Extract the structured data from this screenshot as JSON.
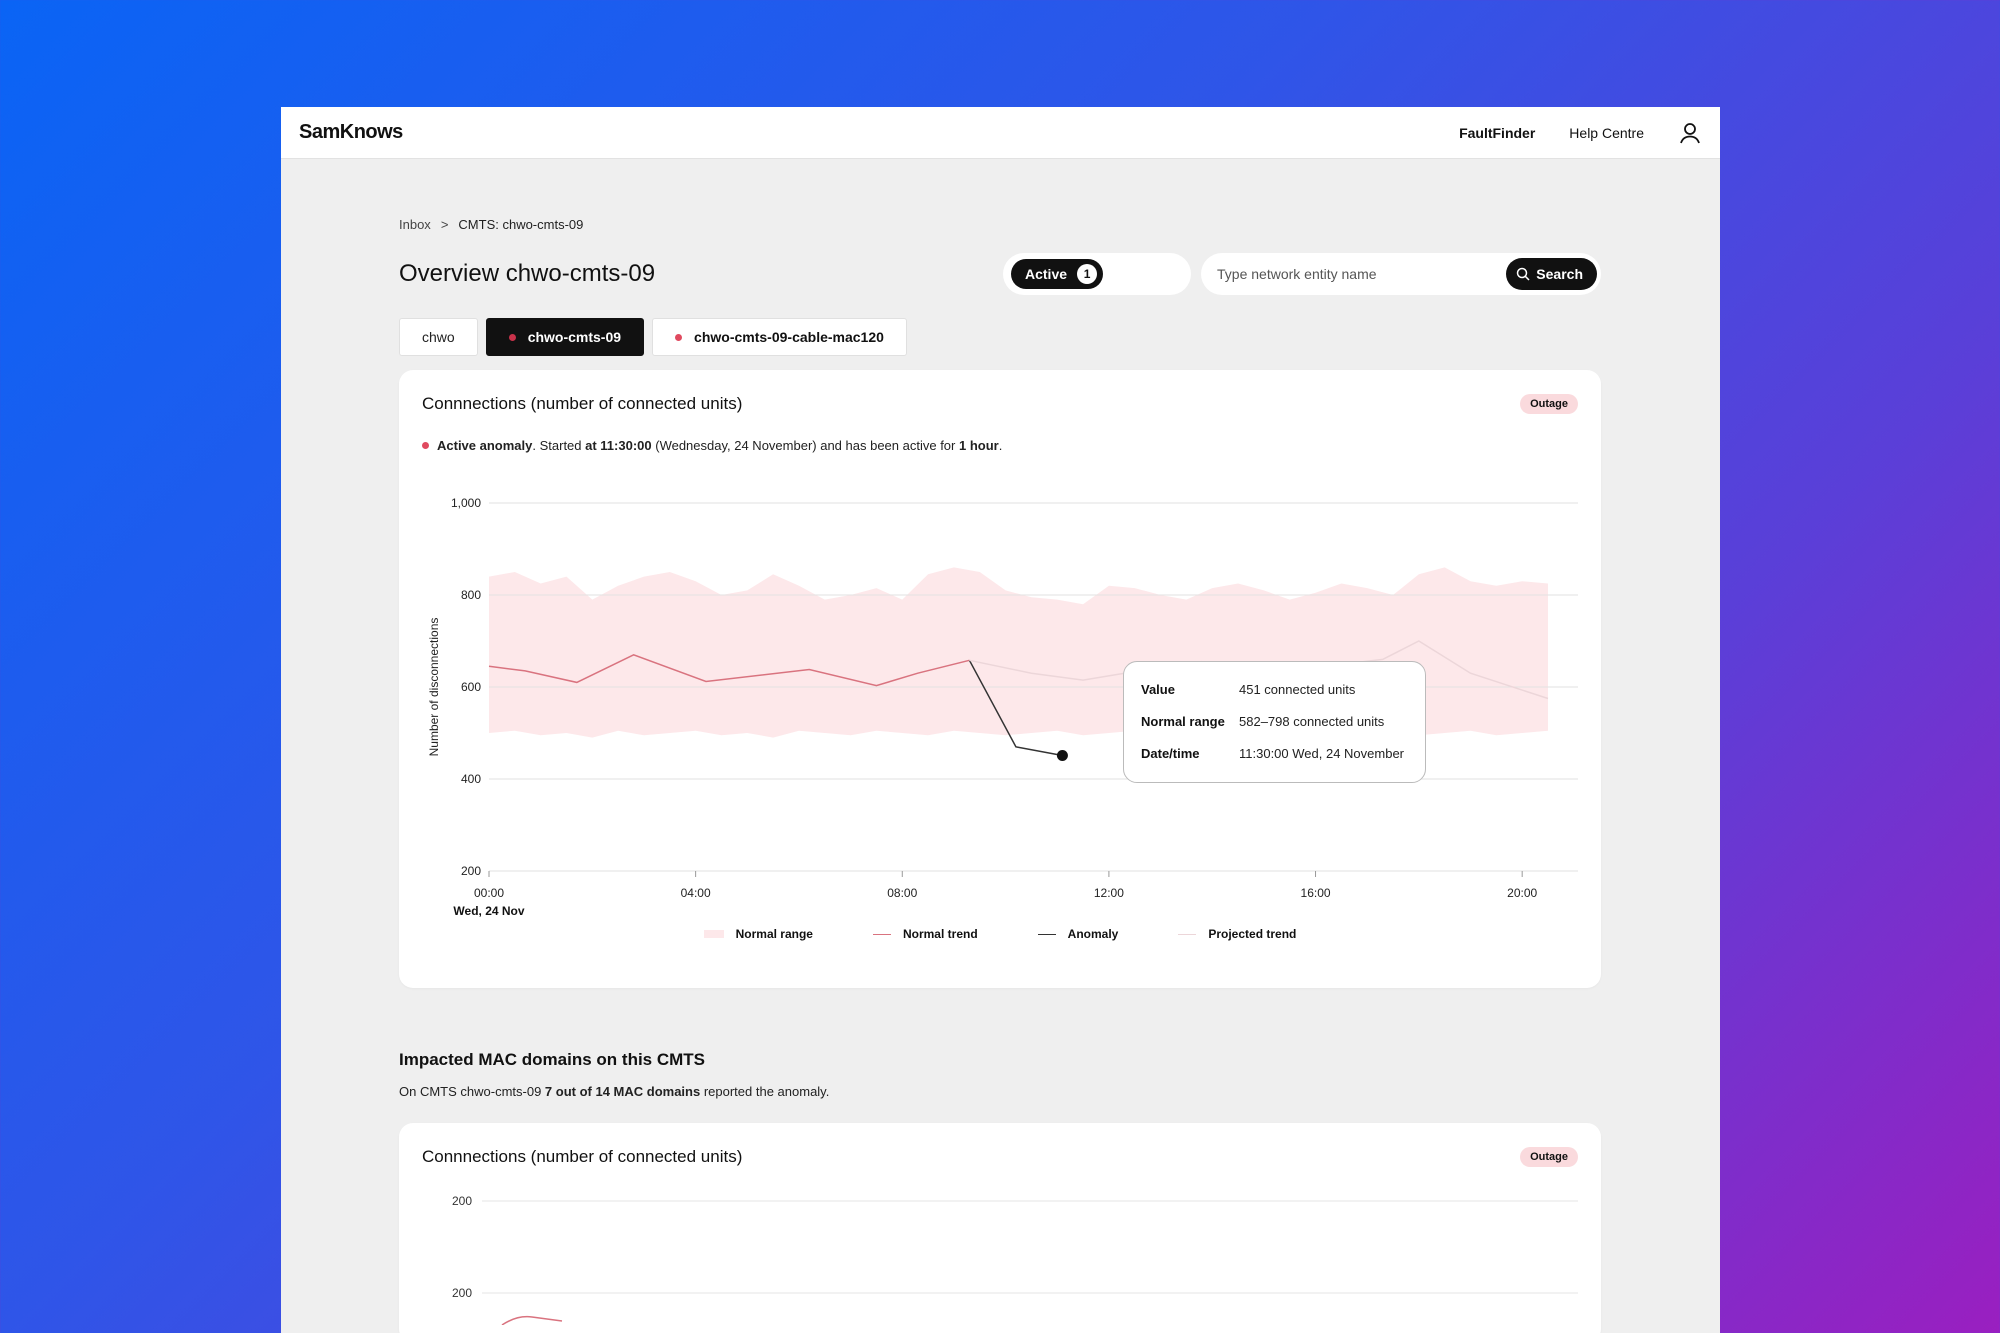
{
  "brand": "SamKnows",
  "nav": {
    "primary": "FaultFinder",
    "help": "Help Centre",
    "profile_icon": "user-icon"
  },
  "breadcrumb": {
    "root": "Inbox",
    "separator": ">",
    "current": "CMTS: chwo-cmts-09"
  },
  "page_title": "Overview chwo-cmts-09",
  "status": {
    "label": "Active",
    "count": "1"
  },
  "search": {
    "placeholder": "Type network entity name",
    "button": "Search"
  },
  "tabs": [
    {
      "label": "chwo",
      "dot": false,
      "active": false
    },
    {
      "label": "chwo-cmts-09",
      "dot": true,
      "active": true
    },
    {
      "label": "chwo-cmts-09-cable-mac120",
      "dot": true,
      "active": false
    }
  ],
  "card1": {
    "title": "Connnections (number of connected units)",
    "badge": "Outage",
    "anomaly": {
      "bold1": "Active anomaly",
      "t1": ". Started ",
      "bold2": "at 11:30:00",
      "t2": " (Wednesday, 24 November) and has been active for ",
      "bold3": "1 hour",
      "t3": "."
    },
    "tooltip": {
      "value_label": "Value",
      "value": "451 connected units",
      "range_label": "Normal range",
      "range": "582–798 connected units",
      "date_label": "Date/time",
      "date": "11:30:00 Wed, 24 November"
    },
    "legend": [
      "Normal range",
      "Normal trend",
      "Anomaly",
      "Projected trend"
    ]
  },
  "chart_data": {
    "type": "line",
    "title": "Connnections (number of connected units)",
    "ylabel": "Number of disconnections",
    "xlabel": "",
    "ylim": [
      200,
      1000
    ],
    "yticks": [
      "1,000",
      "800",
      "600",
      "400",
      "200"
    ],
    "yticks_values": [
      1000,
      800,
      600,
      400,
      200
    ],
    "xlim": [
      0,
      20.5
    ],
    "xticks": [
      "00:00",
      "04:00",
      "08:00",
      "12:00",
      "16:00",
      "20:00"
    ],
    "xticks_values": [
      0,
      4,
      8,
      12,
      16,
      20
    ],
    "xsub": "Wed, 24 Nov",
    "normal_range": {
      "x": [
        0,
        0.5,
        1,
        1.5,
        2,
        2.5,
        3,
        3.5,
        4,
        4.5,
        5,
        5.5,
        6,
        6.5,
        7,
        7.5,
        8,
        8.5,
        9,
        9.5,
        10,
        10.5,
        11,
        11.5,
        12,
        12.5,
        13,
        13.5,
        14,
        14.5,
        15,
        15.5,
        16,
        16.5,
        17,
        17.5,
        18,
        18.5,
        19,
        19.5,
        20,
        20.5
      ],
      "upper": [
        840,
        850,
        825,
        840,
        790,
        820,
        840,
        850,
        830,
        800,
        810,
        845,
        820,
        790,
        800,
        815,
        790,
        845,
        860,
        850,
        810,
        795,
        790,
        780,
        820,
        815,
        800,
        790,
        815,
        825,
        810,
        790,
        805,
        825,
        815,
        800,
        845,
        860,
        830,
        820,
        830,
        825
      ],
      "lower": [
        500,
        505,
        495,
        500,
        490,
        505,
        495,
        500,
        505,
        495,
        500,
        490,
        505,
        500,
        495,
        505,
        500,
        495,
        505,
        500,
        495,
        500,
        505,
        495,
        500,
        505,
        495,
        500,
        505,
        500,
        495,
        505,
        500,
        495,
        500,
        505,
        495,
        500,
        505,
        495,
        500,
        505
      ]
    },
    "series": [
      {
        "name": "Normal trend",
        "color": "#d9737f",
        "x": [
          0,
          0.7,
          1.7,
          2.8,
          4.2,
          6.2,
          7.5,
          8.3,
          9.3
        ],
        "y": [
          645,
          635,
          610,
          670,
          612,
          638,
          603,
          630,
          658
        ]
      },
      {
        "name": "Anomaly",
        "color": "#333333",
        "x": [
          9.3,
          10.2,
          11.1
        ],
        "y": [
          658,
          470,
          451
        ]
      },
      {
        "name": "Projected trend",
        "color": "#ecd6d9",
        "x": [
          9.3,
          10.5,
          11.5,
          12.3,
          13,
          13.8,
          14.8,
          15.8,
          17.3,
          18,
          19,
          20.5
        ],
        "y": [
          658,
          630,
          615,
          630,
          625,
          655,
          625,
          640,
          660,
          700,
          630,
          575
        ]
      }
    ],
    "anomaly_point": {
      "x": 11.1,
      "y": 451
    }
  },
  "section": {
    "title": "Impacted MAC domains on this CMTS",
    "sub_a": "On CMTS chwo-cmts-09 ",
    "sub_bold": "7 out of 14 MAC domains",
    "sub_b": " reported the anomaly."
  },
  "card2": {
    "title": "Connnections (number of connected units)",
    "badge": "Outage",
    "yticks": [
      "200",
      "200"
    ]
  },
  "colors": {
    "accent": "#111111",
    "alert": "#e04a5f",
    "badge_bg": "#fadadd"
  }
}
